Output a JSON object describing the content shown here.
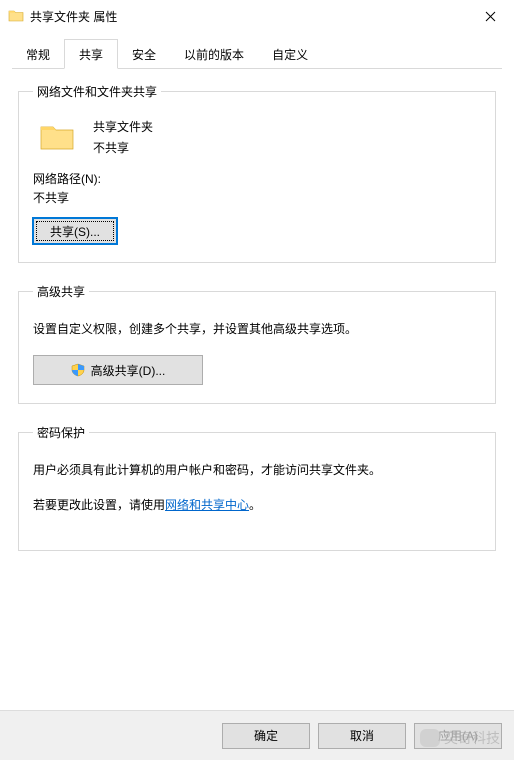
{
  "window": {
    "title": "共享文件夹 属性"
  },
  "tabs": {
    "general": "常规",
    "sharing": "共享",
    "security": "安全",
    "previous": "以前的版本",
    "customize": "自定义"
  },
  "group_network": {
    "legend": "网络文件和文件夹共享",
    "folder_name": "共享文件夹",
    "status": "不共享",
    "path_label": "网络路径(N):",
    "path_value": "不共享",
    "share_button": "共享(S)..."
  },
  "group_advanced": {
    "legend": "高级共享",
    "desc": "设置自定义权限，创建多个共享，并设置其他高级共享选项。",
    "button": "高级共享(D)..."
  },
  "group_password": {
    "legend": "密码保护",
    "line1": "用户必须具有此计算机的用户帐户和密码，才能访问共享文件夹。",
    "line2_pre": "若要更改此设置，请使用",
    "line2_link": "网络和共享中心",
    "line2_post": "。"
  },
  "buttons": {
    "ok": "确定",
    "cancel": "取消",
    "apply": "应用(A)"
  },
  "watermark": "奕奇科技"
}
